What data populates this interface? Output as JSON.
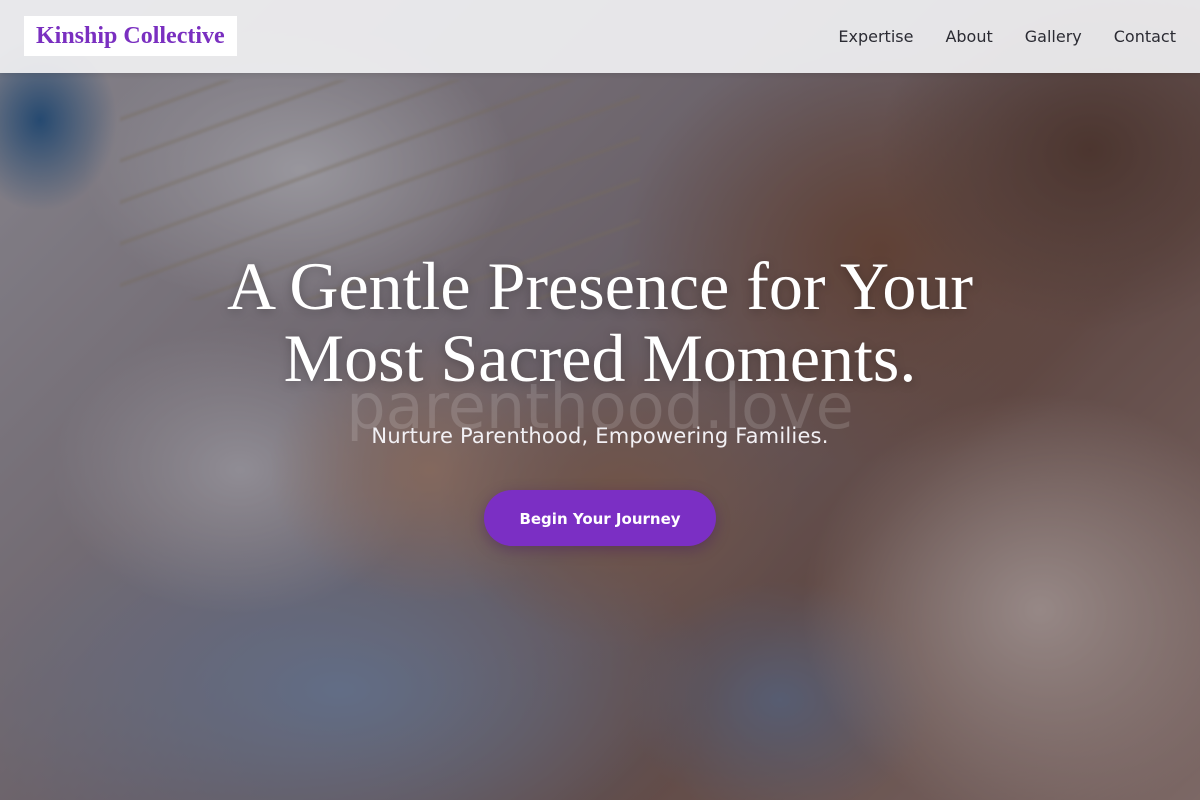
{
  "header": {
    "brand": "Kinship Collective",
    "nav": [
      {
        "label": "Expertise"
      },
      {
        "label": "About"
      },
      {
        "label": "Gallery"
      },
      {
        "label": "Contact"
      }
    ]
  },
  "hero": {
    "title_line1": "A Gentle Presence for Your",
    "title_line2": "Most Sacred Moments.",
    "watermark": "parenthood.love",
    "tagline": "Nurture Parenthood, Empowering Families.",
    "cta_label": "Begin Your Journey",
    "background_image": "photo-newborn-hand-held-by-adult-hand"
  },
  "colors": {
    "brand": "#7a2fc0",
    "cta_background": "#7b2fc4",
    "header_background": "#f0f0f2",
    "nav_text": "#2b2b33",
    "hero_text": "#ffffff"
  }
}
